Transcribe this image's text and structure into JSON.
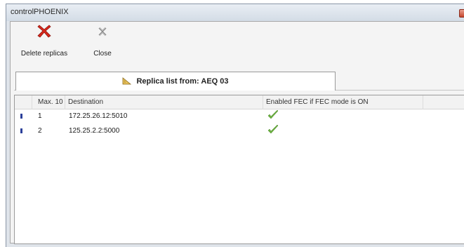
{
  "window": {
    "title": "controlPHOENIX"
  },
  "toolbar": {
    "delete_label": "Delete replicas",
    "delete_icon": "red-x-icon",
    "close_label": "Close",
    "close_icon": "close-x-icon"
  },
  "tab": {
    "label": "Replica list from: AEQ 03",
    "icon": "ruler-icon"
  },
  "grid": {
    "columns": [
      "",
      "Max. 10",
      "Destination",
      "Enabled FEC if FEC mode is ON",
      ""
    ],
    "rows": [
      {
        "index": "1",
        "destination": "172.25.26.12:5010",
        "fec_enabled": true
      },
      {
        "index": "2",
        "destination": "125.25.2.2:5000",
        "fec_enabled": true
      }
    ]
  },
  "colors": {
    "delete_red": "#d8281c",
    "check_green": "#6cb33f",
    "row_marker": "#2b3f9a"
  }
}
